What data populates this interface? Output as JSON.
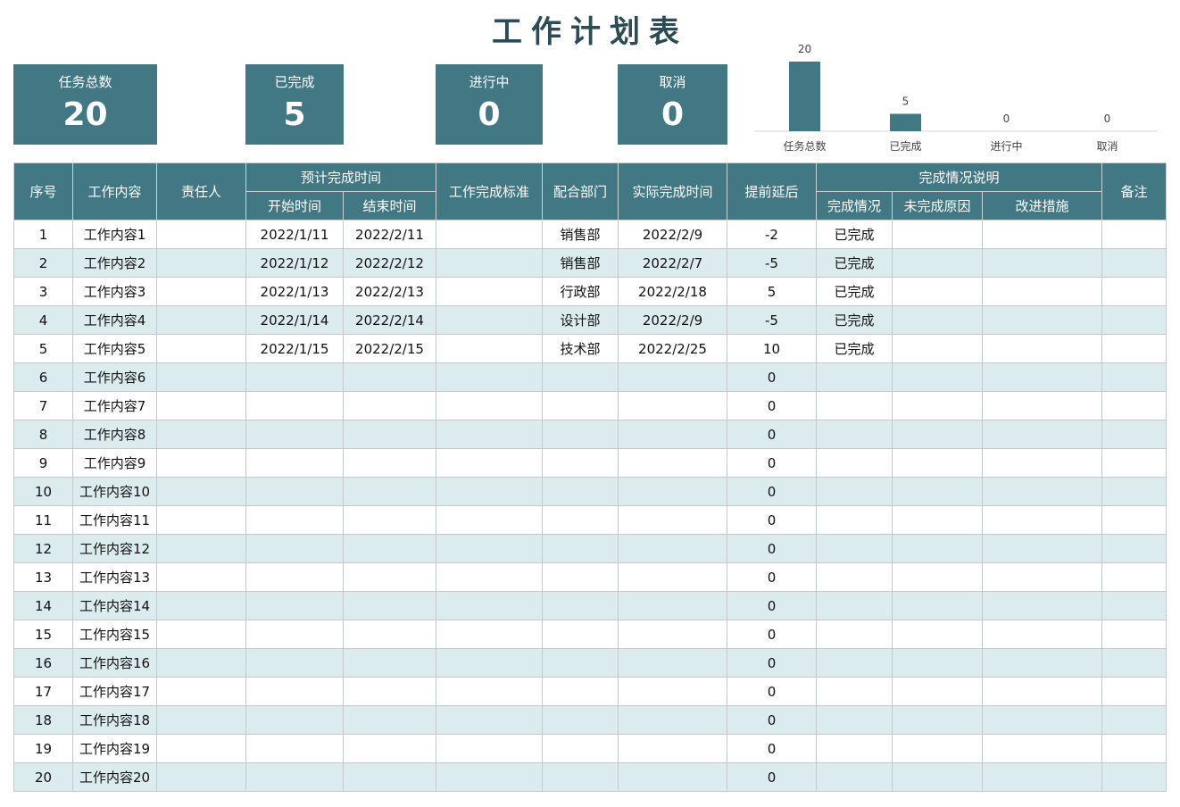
{
  "title": "工作计划表",
  "kpis": [
    {
      "label": "任务总数",
      "value": "20"
    },
    {
      "label": "已完成",
      "value": "5"
    },
    {
      "label": "进行中",
      "value": "0"
    },
    {
      "label": "取消",
      "value": "0"
    }
  ],
  "chart_data": {
    "type": "bar",
    "categories": [
      "任务总数",
      "已完成",
      "进行中",
      "取消"
    ],
    "values": [
      20,
      5,
      0,
      0
    ],
    "title": "",
    "xlabel": "",
    "ylabel": "",
    "ylim": [
      0,
      20
    ],
    "grid": false,
    "data_labels": true,
    "color": "#427884"
  },
  "table": {
    "headers": {
      "seq": "序号",
      "content": "工作内容",
      "owner": "责任人",
      "planned": "预计完成时间",
      "start": "开始时间",
      "end": "结束时间",
      "standard": "工作完成标准",
      "dept": "配合部门",
      "actual": "实际完成时间",
      "diff": "提前延后",
      "completion": "完成情况说明",
      "status": "完成情况",
      "reason": "未完成原因",
      "improve": "改进措施",
      "note": "备注"
    },
    "rows": [
      {
        "seq": "1",
        "content": "工作内容1",
        "owner": "",
        "start": "2022/1/11",
        "end": "2022/2/11",
        "standard": "",
        "dept": "销售部",
        "actual": "2022/2/9",
        "diff": "-2",
        "status": "已完成",
        "reason": "",
        "improve": "",
        "note": ""
      },
      {
        "seq": "2",
        "content": "工作内容2",
        "owner": "",
        "start": "2022/1/12",
        "end": "2022/2/12",
        "standard": "",
        "dept": "销售部",
        "actual": "2022/2/7",
        "diff": "-5",
        "status": "已完成",
        "reason": "",
        "improve": "",
        "note": ""
      },
      {
        "seq": "3",
        "content": "工作内容3",
        "owner": "",
        "start": "2022/1/13",
        "end": "2022/2/13",
        "standard": "",
        "dept": "行政部",
        "actual": "2022/2/18",
        "diff": "5",
        "status": "已完成",
        "reason": "",
        "improve": "",
        "note": ""
      },
      {
        "seq": "4",
        "content": "工作内容4",
        "owner": "",
        "start": "2022/1/14",
        "end": "2022/2/14",
        "standard": "",
        "dept": "设计部",
        "actual": "2022/2/9",
        "diff": "-5",
        "status": "已完成",
        "reason": "",
        "improve": "",
        "note": ""
      },
      {
        "seq": "5",
        "content": "工作内容5",
        "owner": "",
        "start": "2022/1/15",
        "end": "2022/2/15",
        "standard": "",
        "dept": "技术部",
        "actual": "2022/2/25",
        "diff": "10",
        "status": "已完成",
        "reason": "",
        "improve": "",
        "note": ""
      },
      {
        "seq": "6",
        "content": "工作内容6",
        "owner": "",
        "start": "",
        "end": "",
        "standard": "",
        "dept": "",
        "actual": "",
        "diff": "0",
        "status": "",
        "reason": "",
        "improve": "",
        "note": ""
      },
      {
        "seq": "7",
        "content": "工作内容7",
        "owner": "",
        "start": "",
        "end": "",
        "standard": "",
        "dept": "",
        "actual": "",
        "diff": "0",
        "status": "",
        "reason": "",
        "improve": "",
        "note": ""
      },
      {
        "seq": "8",
        "content": "工作内容8",
        "owner": "",
        "start": "",
        "end": "",
        "standard": "",
        "dept": "",
        "actual": "",
        "diff": "0",
        "status": "",
        "reason": "",
        "improve": "",
        "note": ""
      },
      {
        "seq": "9",
        "content": "工作内容9",
        "owner": "",
        "start": "",
        "end": "",
        "standard": "",
        "dept": "",
        "actual": "",
        "diff": "0",
        "status": "",
        "reason": "",
        "improve": "",
        "note": ""
      },
      {
        "seq": "10",
        "content": "工作内容10",
        "owner": "",
        "start": "",
        "end": "",
        "standard": "",
        "dept": "",
        "actual": "",
        "diff": "0",
        "status": "",
        "reason": "",
        "improve": "",
        "note": ""
      },
      {
        "seq": "11",
        "content": "工作内容11",
        "owner": "",
        "start": "",
        "end": "",
        "standard": "",
        "dept": "",
        "actual": "",
        "diff": "0",
        "status": "",
        "reason": "",
        "improve": "",
        "note": ""
      },
      {
        "seq": "12",
        "content": "工作内容12",
        "owner": "",
        "start": "",
        "end": "",
        "standard": "",
        "dept": "",
        "actual": "",
        "diff": "0",
        "status": "",
        "reason": "",
        "improve": "",
        "note": ""
      },
      {
        "seq": "13",
        "content": "工作内容13",
        "owner": "",
        "start": "",
        "end": "",
        "standard": "",
        "dept": "",
        "actual": "",
        "diff": "0",
        "status": "",
        "reason": "",
        "improve": "",
        "note": ""
      },
      {
        "seq": "14",
        "content": "工作内容14",
        "owner": "",
        "start": "",
        "end": "",
        "standard": "",
        "dept": "",
        "actual": "",
        "diff": "0",
        "status": "",
        "reason": "",
        "improve": "",
        "note": ""
      },
      {
        "seq": "15",
        "content": "工作内容15",
        "owner": "",
        "start": "",
        "end": "",
        "standard": "",
        "dept": "",
        "actual": "",
        "diff": "0",
        "status": "",
        "reason": "",
        "improve": "",
        "note": ""
      },
      {
        "seq": "16",
        "content": "工作内容16",
        "owner": "",
        "start": "",
        "end": "",
        "standard": "",
        "dept": "",
        "actual": "",
        "diff": "0",
        "status": "",
        "reason": "",
        "improve": "",
        "note": ""
      },
      {
        "seq": "17",
        "content": "工作内容17",
        "owner": "",
        "start": "",
        "end": "",
        "standard": "",
        "dept": "",
        "actual": "",
        "diff": "0",
        "status": "",
        "reason": "",
        "improve": "",
        "note": ""
      },
      {
        "seq": "18",
        "content": "工作内容18",
        "owner": "",
        "start": "",
        "end": "",
        "standard": "",
        "dept": "",
        "actual": "",
        "diff": "0",
        "status": "",
        "reason": "",
        "improve": "",
        "note": ""
      },
      {
        "seq": "19",
        "content": "工作内容19",
        "owner": "",
        "start": "",
        "end": "",
        "standard": "",
        "dept": "",
        "actual": "",
        "diff": "0",
        "status": "",
        "reason": "",
        "improve": "",
        "note": ""
      },
      {
        "seq": "20",
        "content": "工作内容20",
        "owner": "",
        "start": "",
        "end": "",
        "standard": "",
        "dept": "",
        "actual": "",
        "diff": "0",
        "status": "",
        "reason": "",
        "improve": "",
        "note": ""
      }
    ]
  }
}
